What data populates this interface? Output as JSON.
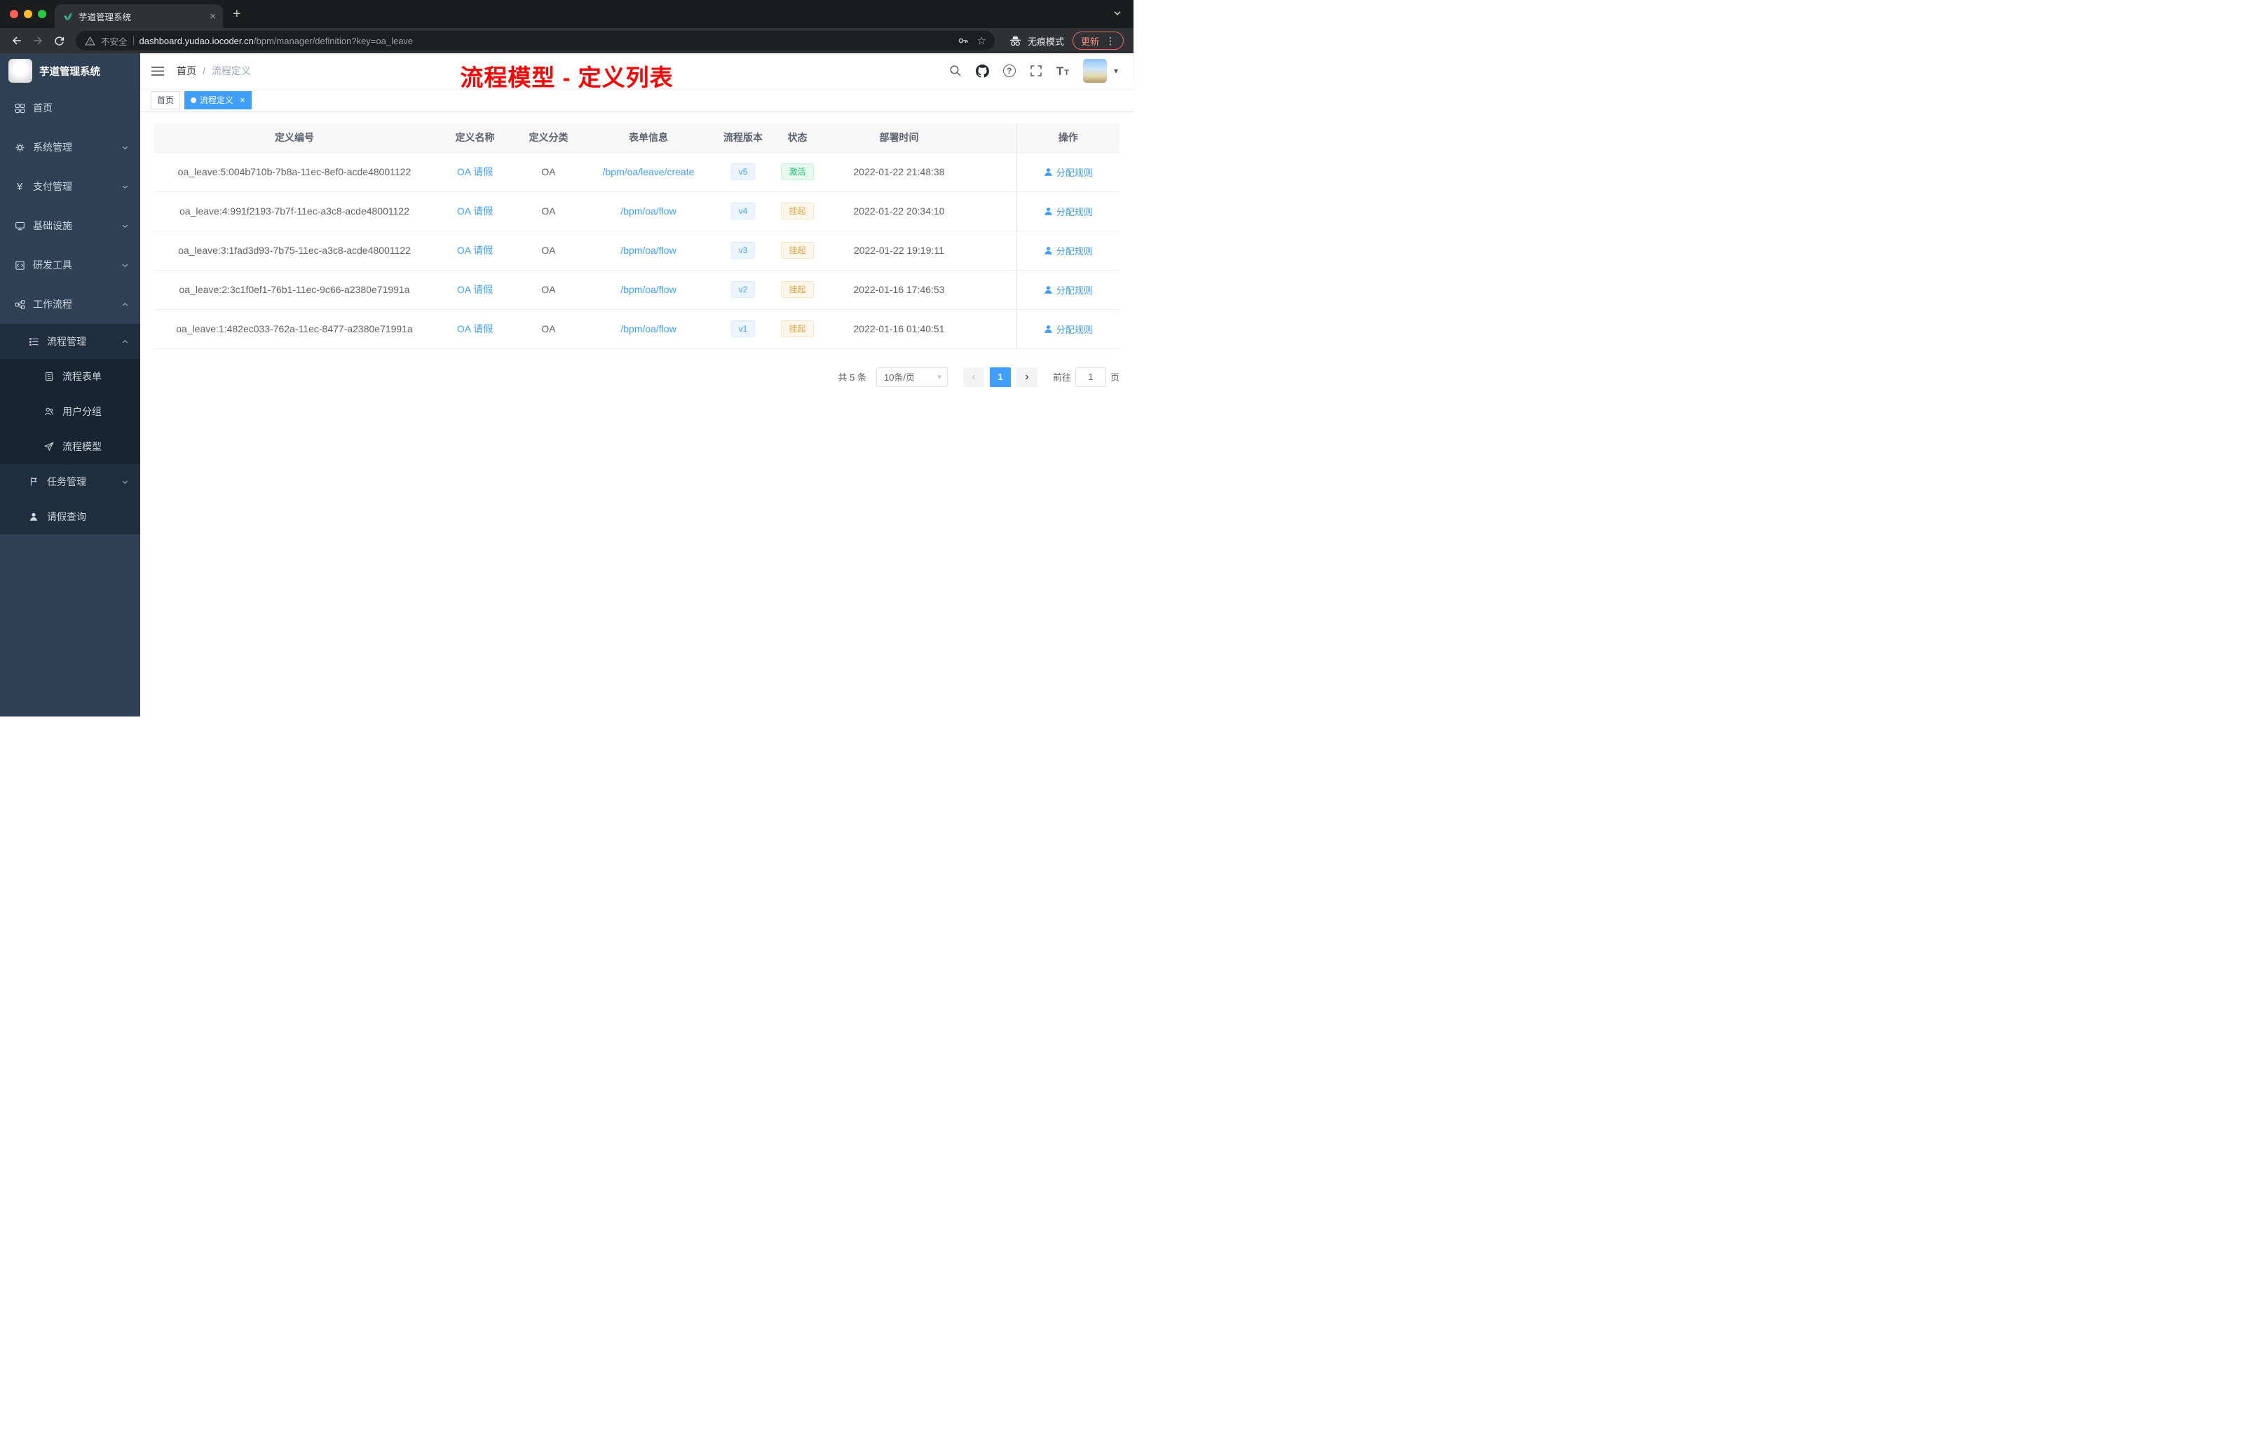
{
  "browser": {
    "tab_title": "芋道管理系统",
    "tab_close_glyph": "×",
    "new_tab_glyph": "+",
    "security_label": "不安全",
    "url_host": "dashboard.yudao.iocoder.cn",
    "url_path": "/bpm/manager/definition?key=oa_leave",
    "incognito_label": "无痕模式",
    "update_label": "更新"
  },
  "icons": {
    "star_glyph": "☆",
    "caret_down_glyph": "▾",
    "dots_vertical_glyph": "⋮",
    "question_glyph": "?",
    "yen_glyph": "¥",
    "letter_T_big": "T",
    "letter_T_small": "T",
    "chevron_left_glyph": "‹",
    "chevron_right_glyph": "›"
  },
  "sidebar": {
    "app_title": "芋道管理系统",
    "menu": [
      {
        "label": "首页"
      },
      {
        "label": "系统管理"
      },
      {
        "label": "支付管理"
      },
      {
        "label": "基础设施"
      },
      {
        "label": "研发工具"
      },
      {
        "label": "工作流程"
      },
      {
        "label": "流程管理"
      },
      {
        "label": "流程表单"
      },
      {
        "label": "用户分组"
      },
      {
        "label": "流程模型"
      },
      {
        "label": "任务管理"
      },
      {
        "label": "请假查询"
      }
    ]
  },
  "navbar": {
    "breadcrumb": [
      "首页",
      "流程定义"
    ],
    "breadcrumb_sep": "/",
    "annotation": "流程模型 - 定义列表"
  },
  "tags": [
    {
      "label": "首页"
    },
    {
      "label": "流程定义",
      "close": "×"
    }
  ],
  "table": {
    "headers": [
      "定义编号",
      "定义名称",
      "定义分类",
      "表单信息",
      "流程版本",
      "状态",
      "部署时间",
      "操作"
    ],
    "rows": [
      {
        "id": "oa_leave:5:004b710b-7b8a-11ec-8ef0-acde48001122",
        "name": "OA 请假",
        "category": "OA",
        "form": "/bpm/oa/leave/create",
        "version": "v5",
        "status": "激活",
        "time": "2022-01-22 21:48:38",
        "action": "分配规则"
      },
      {
        "id": "oa_leave:4:991f2193-7b7f-11ec-a3c8-acde48001122",
        "name": "OA 请假",
        "category": "OA",
        "form": "/bpm/oa/flow",
        "version": "v4",
        "status": "挂起",
        "time": "2022-01-22 20:34:10",
        "action": "分配规则"
      },
      {
        "id": "oa_leave:3:1fad3d93-7b75-11ec-a3c8-acde48001122",
        "name": "OA 请假",
        "category": "OA",
        "form": "/bpm/oa/flow",
        "version": "v3",
        "status": "挂起",
        "time": "2022-01-22 19:19:11",
        "action": "分配规则"
      },
      {
        "id": "oa_leave:2:3c1f0ef1-76b1-11ec-9c66-a2380e71991a",
        "name": "OA 请假",
        "category": "OA",
        "form": "/bpm/oa/flow",
        "version": "v2",
        "status": "挂起",
        "time": "2022-01-16 17:46:53",
        "action": "分配规则"
      },
      {
        "id": "oa_leave:1:482ec033-762a-11ec-8477-a2380e71991a",
        "name": "OA 请假",
        "category": "OA",
        "form": "/bpm/oa/flow",
        "version": "v1",
        "status": "挂起",
        "time": "2022-01-16 01:40:51",
        "action": "分配规则"
      }
    ]
  },
  "pagination": {
    "total": "共 5 条",
    "page_size": "10条/页",
    "current_page": "1",
    "goto_label": "前往",
    "goto_value": "1",
    "goto_suffix": "页"
  },
  "colors": {
    "accent": "#409eff",
    "success": "#19be6b",
    "warning": "#e6a23c",
    "sidebar_bg": "#304156",
    "submenu_bg": "#1f2d3d",
    "annotation": "#ff0000"
  }
}
